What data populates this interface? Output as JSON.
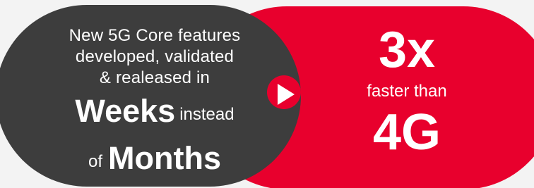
{
  "left_panel": {
    "intro_lines": [
      "New 5G Core features",
      "developed, validated",
      "& realeased in"
    ],
    "emphasis_1": "Weeks",
    "connector_1": "instead",
    "connector_2": "of",
    "emphasis_2": "Months"
  },
  "right_panel": {
    "multiplier": "3x",
    "comparison": "faster than",
    "technology": "4G"
  },
  "colors": {
    "dark_background": "#3d3d3d",
    "accent_red": "#e8002d",
    "page_background": "#f3f3f3",
    "text": "#ffffff"
  },
  "icons": {
    "pointer": "play-triangle"
  }
}
